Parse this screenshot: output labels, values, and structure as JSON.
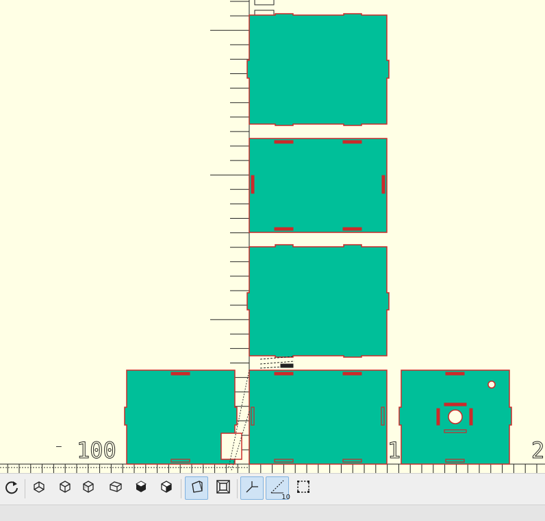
{
  "viewport": {
    "background_color": "#ffffe5",
    "panel_fill_color": "#00bf99",
    "panel_edge_color": "#cc2a2a",
    "axis_label_x_neg": "100",
    "axis_label_x_pos": "100",
    "axis_label_x_far": "2"
  },
  "toolbar": {
    "buttons": [
      {
        "name": "reset-view-button",
        "icon": "reset-view-icon",
        "active": false
      },
      {
        "name": "view-bottom-button",
        "icon": "view-bottom-icon",
        "active": false
      },
      {
        "name": "view-top-button",
        "icon": "view-top-icon",
        "active": false
      },
      {
        "name": "view-left-button",
        "icon": "view-left-icon",
        "active": false
      },
      {
        "name": "view-right-button",
        "icon": "view-right-icon",
        "active": false
      },
      {
        "name": "view-front-button",
        "icon": "view-front-icon",
        "active": false
      },
      {
        "name": "view-back-button",
        "icon": "view-back-icon",
        "active": false
      },
      {
        "name": "perspective-button",
        "icon": "perspective-icon",
        "active": true
      },
      {
        "name": "orthogonal-button",
        "icon": "orthogonal-icon",
        "active": false
      },
      {
        "name": "show-axes-button",
        "icon": "axes-icon",
        "active": true
      },
      {
        "name": "show-scale-button",
        "icon": "scale-markers-icon",
        "active": true
      },
      {
        "name": "show-edges-button",
        "icon": "edges-icon",
        "active": false
      }
    ],
    "scale_badge": "10"
  },
  "status": {
    "text": ""
  }
}
